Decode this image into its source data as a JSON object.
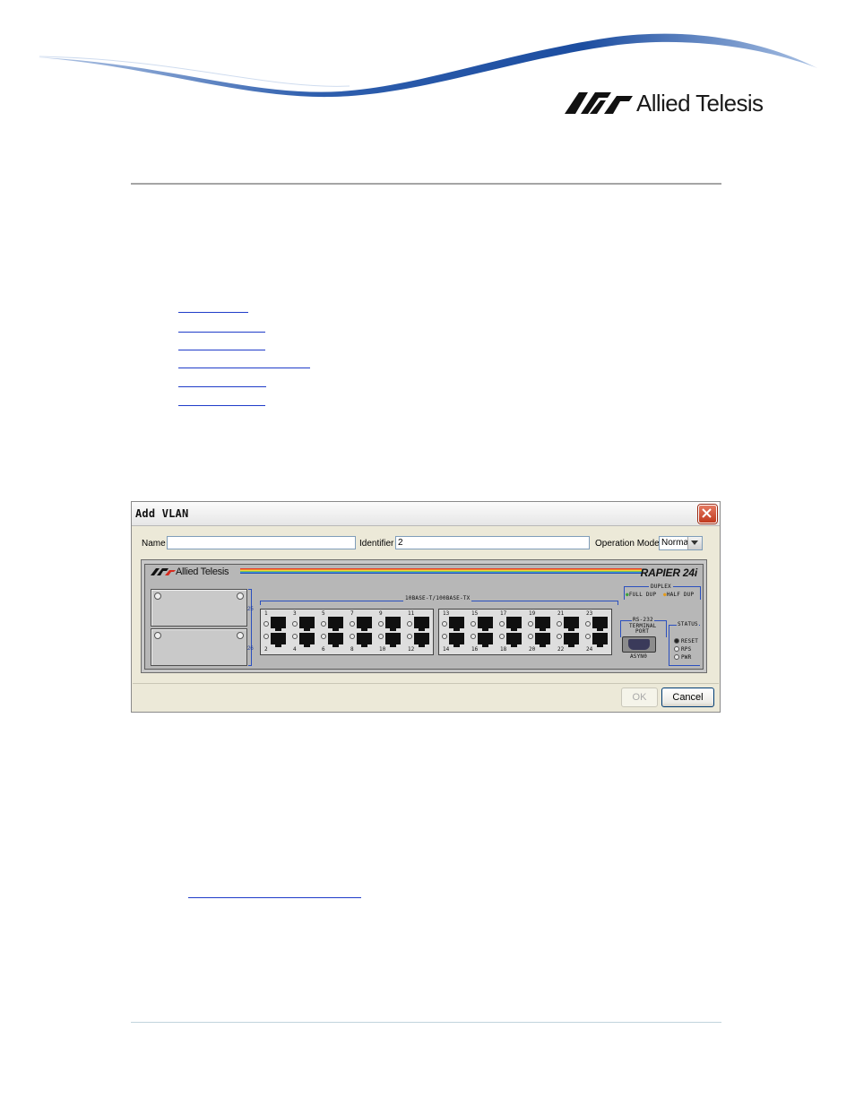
{
  "header": {
    "brand": "Allied Telesis",
    "colors": {
      "swoosh": "#1c4da0",
      "swoosh_light": "#7fa4d6",
      "rule": "#a5a5a5",
      "link": "#1f3cc9"
    }
  },
  "toc_links": [
    {
      "label": "",
      "width": 78
    },
    {
      "label": "",
      "width": 97
    },
    {
      "label": "",
      "width": 97
    },
    {
      "label": "",
      "width": 147
    },
    {
      "label": "",
      "width": 98
    },
    {
      "label": "",
      "width": 97
    }
  ],
  "dialog": {
    "title": "Add VLAN",
    "name_label": "Name",
    "name_value": "",
    "identifier_label": "Identifier",
    "identifier_value": "2",
    "operation_mode_label": "Operation Mode",
    "operation_mode_value": "Normal",
    "ok_label": "OK",
    "cancel_label": "Cancel"
  },
  "device": {
    "brand": "Allied Telesis",
    "model": "RAPIER 24i",
    "ports_label": "10BASE-T/100BASE-TX",
    "slot_numbers": [
      "25",
      "26"
    ],
    "duplex_label": "DUPLEX",
    "full_dup_label": "FULL DUP",
    "half_dup_label": "HALF DUP",
    "rs232_label_1": "RS-232",
    "rs232_label_2": "TERMINAL",
    "rs232_label_3": "PORT",
    "rs232_sub": "ASYN0",
    "status_label": "STATUS",
    "status_items": [
      "RESET",
      "RPS",
      "PWR"
    ],
    "port_numbers_top": [
      "1",
      "3",
      "5",
      "7",
      "9",
      "11",
      "13",
      "15",
      "17",
      "19",
      "21",
      "23"
    ],
    "port_numbers_bottom": [
      "2",
      "4",
      "6",
      "8",
      "10",
      "12",
      "14",
      "16",
      "18",
      "20",
      "22",
      "24"
    ]
  }
}
